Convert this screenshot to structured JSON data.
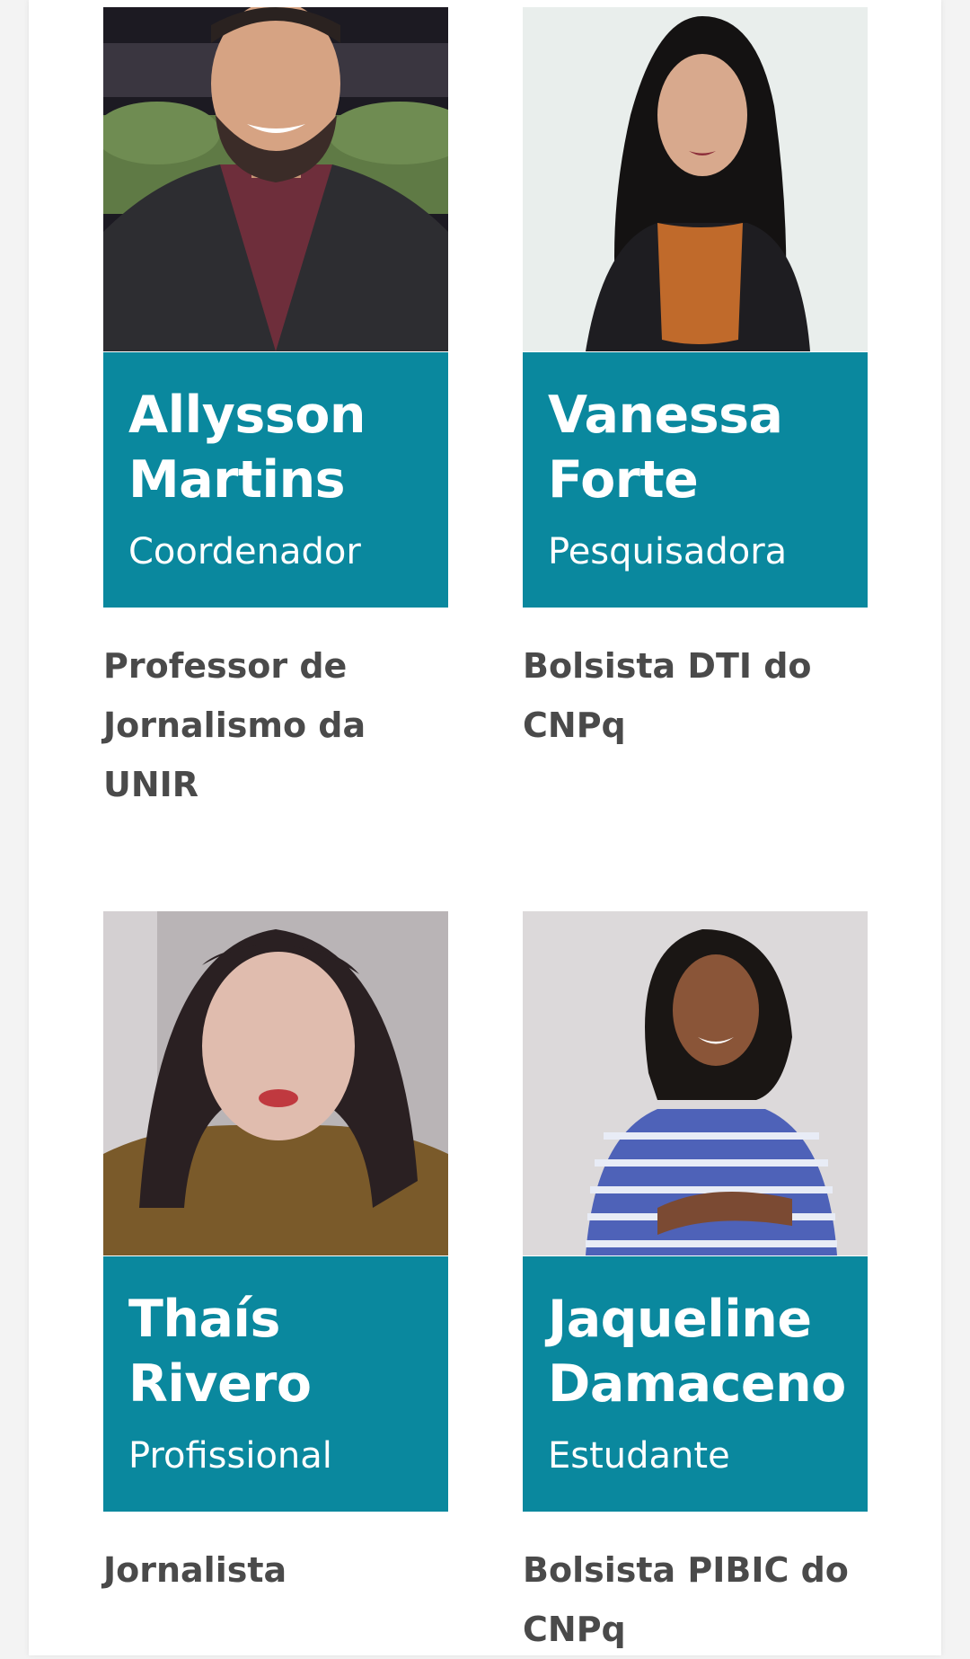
{
  "members": [
    {
      "name_line1": "Allysson",
      "name_line2": "Martins",
      "role": "Coordenador",
      "desc_lines": [
        "Professor de",
        "Jornalismo da",
        "UNIR"
      ]
    },
    {
      "name_line1": "Vanessa",
      "name_line2": "Forte",
      "role": "Pesquisadora",
      "desc_lines": [
        "Bolsista DTI do",
        "CNPq"
      ]
    },
    {
      "name_line1": "Thaís",
      "name_line2": "Rivero",
      "role": "Profissional",
      "desc_lines": [
        "Jornalista"
      ]
    },
    {
      "name_line1": "Jaqueline",
      "name_line2": "Damaceno",
      "role": "Estudante",
      "desc_lines": [
        "Bolsista PIBIC do",
        "CNPq"
      ]
    }
  ],
  "colors": {
    "banner": "#0a889e",
    "description_text": "#4a4a4a"
  }
}
